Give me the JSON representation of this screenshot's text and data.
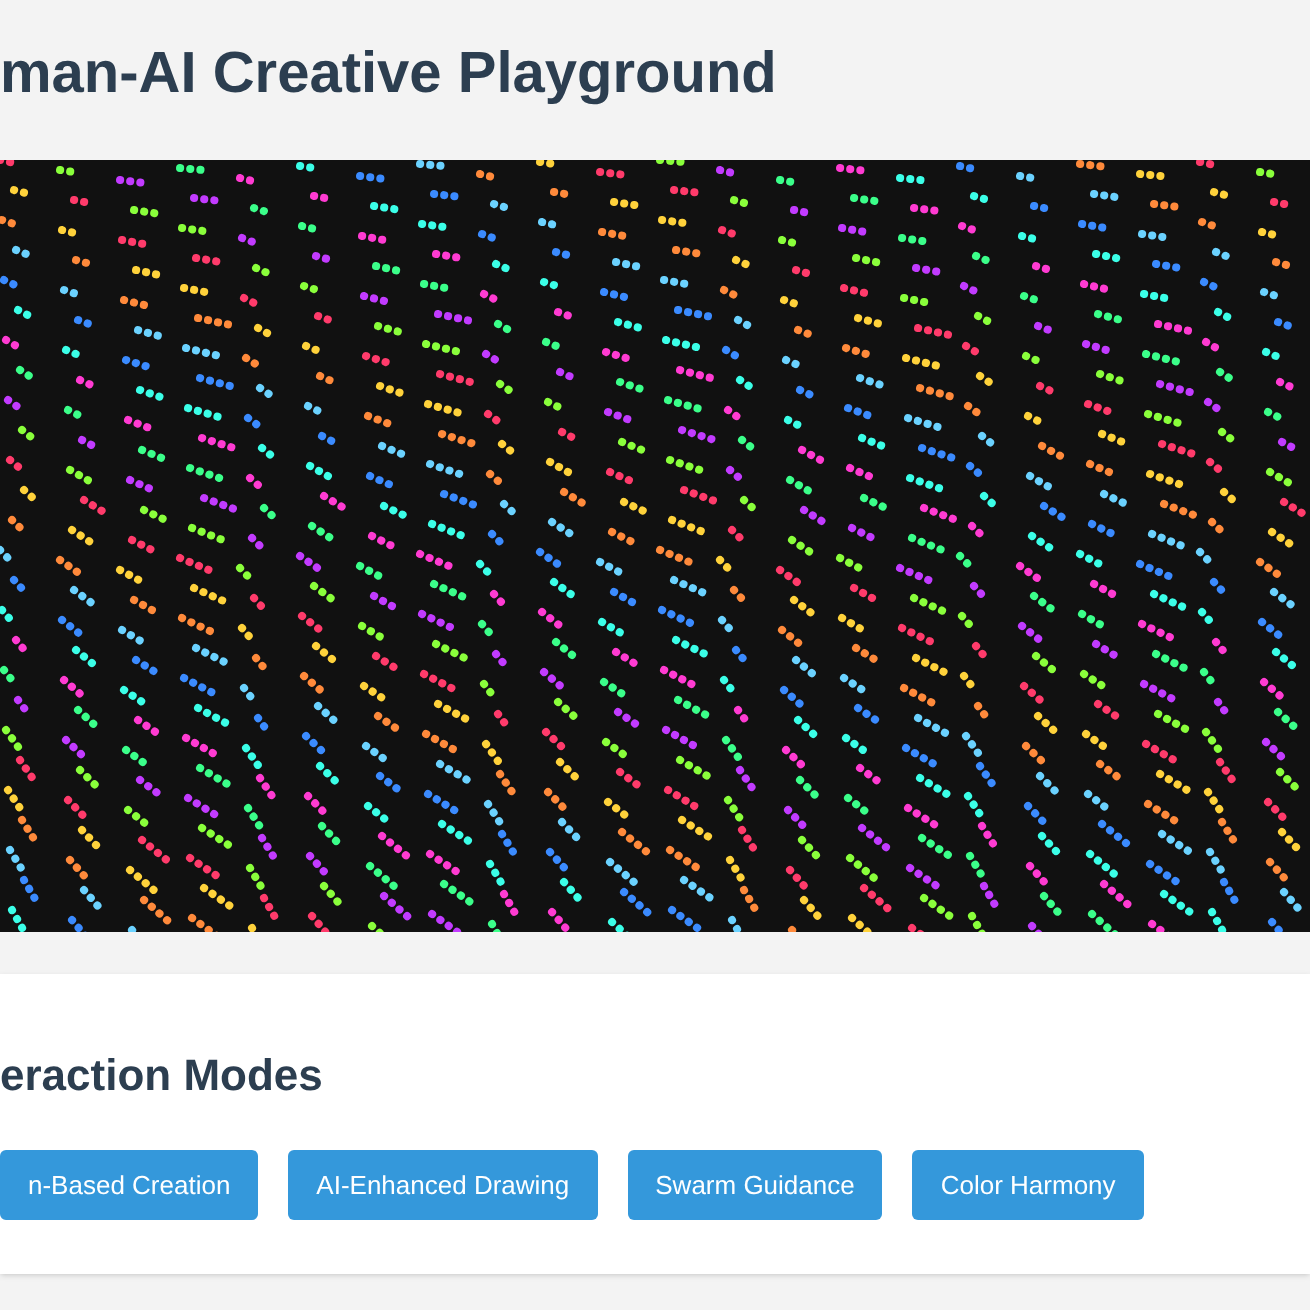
{
  "title": "man-AI Creative Playground",
  "modes": {
    "heading": "eraction Modes",
    "buttons": [
      "n-Based Creation",
      "AI-Enhanced Drawing",
      "Swarm Guidance",
      "Color Harmony"
    ]
  }
}
